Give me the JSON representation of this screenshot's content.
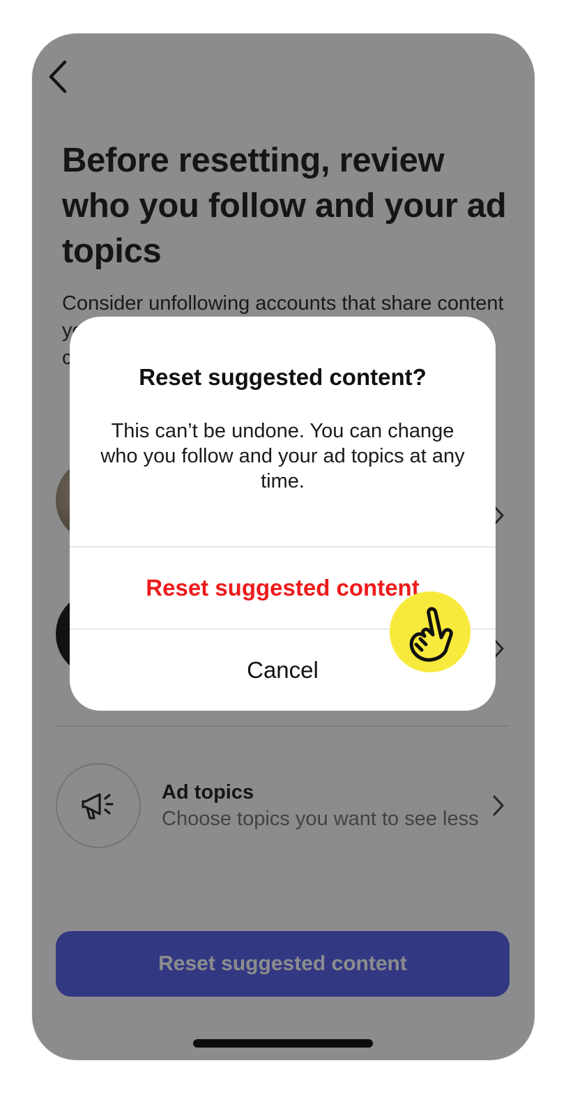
{
  "header": {
    "back_icon": "chevron-left-icon"
  },
  "main": {
    "headline": "Before resetting, review who you follow and your ad topics",
    "intro": "Consider unfollowing accounts that share content you don't want to see more of. You can also choose ad topics you want to see less."
  },
  "rows": [
    {
      "title": "",
      "subtitle": "",
      "icon": "profile-photo"
    },
    {
      "title": "",
      "subtitle": "",
      "icon": "profile-photo"
    },
    {
      "title": "Ad topics",
      "subtitle": "Choose topics you want to see less",
      "icon": "megaphone-icon"
    }
  ],
  "footer": {
    "primary_label": "Reset suggested content"
  },
  "dialog": {
    "title": "Reset suggested content?",
    "body": "This can’t be undone. You can change who you follow and your ad topics at any time.",
    "confirm_label": "Reset suggested content",
    "cancel_label": "Cancel"
  },
  "overlay": {
    "tap_indicator_icon": "pointing-hand-icon"
  },
  "colors": {
    "primary_button": "#4a57e6",
    "destructive_text": "#ee1b1b",
    "tap_indicator": "#f8ea3c"
  }
}
